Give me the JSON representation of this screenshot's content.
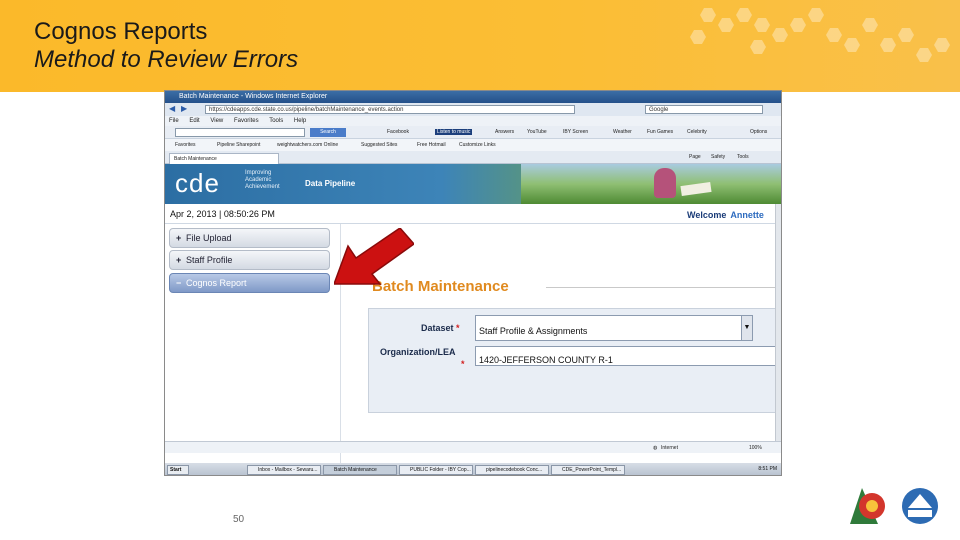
{
  "slide": {
    "title_line1": "Cognos Reports",
    "title_line2": "Method to Review Errors",
    "page_number": "50"
  },
  "browser": {
    "window_title": "Batch Maintenance - Windows Internet Explorer",
    "url": "https://cdeapps.cde.state.co.us/pipeline/batchMaintenance_events.action",
    "search_placeholder": "Google",
    "menu": [
      "File",
      "Edit",
      "View",
      "Favorites",
      "Tools",
      "Help"
    ],
    "toolbar": {
      "search_button": "Search",
      "items": [
        "Facebook",
        "Listen to music",
        "Answers",
        "YouTube",
        "IBY Screen",
        "Weather",
        "Fun Games",
        "Celebrity",
        "Options"
      ]
    },
    "favorites": [
      "Favorites",
      "Pipeline Sharepoint",
      "weightwatchers.com Online",
      "Suggested Sites",
      "Free Hotmail",
      "Customize Links"
    ],
    "tab_label": "Batch Maintenance",
    "tab_tools": [
      "Page",
      "Safety",
      "Tools"
    ],
    "status_right": "Internet",
    "zoom": "100%"
  },
  "page": {
    "logo": "cde",
    "tagline": [
      "Improving",
      "Academic",
      "Achievement"
    ],
    "app_name": "Data Pipeline",
    "datetime": "Apr 2, 2013 | 08:50:26 PM",
    "welcome_label": "Welcome",
    "welcome_name": "Annette",
    "nav": [
      {
        "label": "File Upload",
        "sign": "+"
      },
      {
        "label": "Staff Profile",
        "sign": "+"
      },
      {
        "label": "Cognos Report",
        "sign": "−"
      }
    ],
    "section_title": "Batch Maintenance",
    "form": {
      "dataset_label": "Dataset",
      "dataset_value": "Staff Profile & Assignments",
      "org_label": "Organization/LEA",
      "org_value": "1420-JEFFERSON COUNTY R-1",
      "required_mark": "*"
    }
  },
  "taskbar": {
    "start": "Start",
    "items": [
      "Inbox - Mailbox - Sewaru...",
      "Batch Maintenance",
      "PUBLIC Folder - IBY Cop...",
      "pipelinecodebook Conc...",
      "CDE_PowerPoint_Templ..."
    ],
    "clock": "8:51 PM"
  },
  "colors": {
    "header_band": "#fbb92a",
    "accent_orange": "#e08a1f",
    "arrow_red": "#cc1111",
    "nav_active": "#7f99c7"
  }
}
